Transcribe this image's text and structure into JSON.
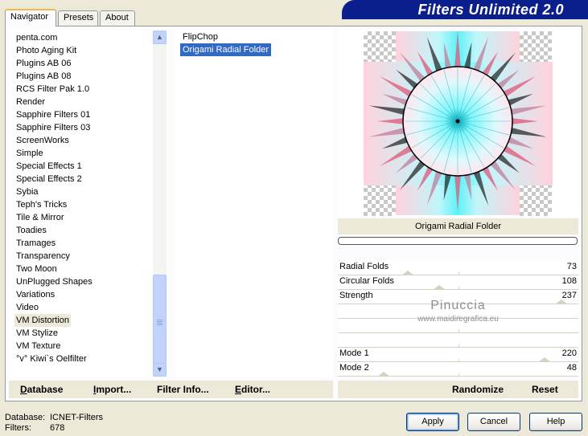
{
  "window": {
    "title": "Filters Unlimited 2.0"
  },
  "tabs": [
    {
      "label": "Navigator",
      "active": true
    },
    {
      "label": "Presets",
      "active": false
    },
    {
      "label": "About",
      "active": false
    }
  ],
  "categories": {
    "items": [
      "penta.com",
      "Photo Aging Kit",
      "Plugins AB 06",
      "Plugins AB 08",
      "RCS Filter Pak 1.0",
      "Render",
      "Sapphire Filters 01",
      "Sapphire Filters 03",
      "ScreenWorks",
      "Simple",
      "Special Effects 1",
      "Special Effects 2",
      "Sybia",
      "Teph's Tricks",
      "Tile & Mirror",
      "Toadies",
      "Tramages",
      "Transparency",
      "Two Moon",
      "UnPlugged Shapes",
      "Variations",
      "Video",
      "VM Distortion",
      "VM Stylize",
      "VM Texture",
      "°v° Kiwi`s Oelfilter"
    ],
    "selected_index": 22
  },
  "filters": {
    "items": [
      "FlipChop",
      "Origami Radial Folder"
    ],
    "selected_index": 1
  },
  "preview": {
    "filter_name": "Origami Radial Folder"
  },
  "sliders": [
    {
      "label": "Radial Folds",
      "value": "73",
      "fraction": 0.29
    },
    {
      "label": "Circular Folds",
      "value": "108",
      "fraction": 0.42
    },
    {
      "label": "Strength",
      "value": "237",
      "fraction": 0.93
    },
    {
      "label": "Mode 1",
      "value": "220",
      "fraction": 0.86
    },
    {
      "label": "Mode 2",
      "value": "48",
      "fraction": 0.19
    }
  ],
  "watermark": {
    "line1": "Pinuccia",
    "line2": "www.maidiregrafica.eu"
  },
  "left_buttons": [
    {
      "label": "Database",
      "underline": "D",
      "rest": "atabase"
    },
    {
      "label": "Import...",
      "underline": "I",
      "rest": "mport..."
    },
    {
      "label": "Filter Info...",
      "underline": "",
      "rest": "Filter Info..."
    },
    {
      "label": "Editor...",
      "underline": "E",
      "rest": "ditor..."
    }
  ],
  "right_buttons": {
    "randomize": "Randomize",
    "reset": "Reset"
  },
  "status": {
    "database_label": "Database:",
    "database_value": "ICNET-Filters",
    "filters_label": "Filters:",
    "filters_value": "678"
  },
  "dialog_buttons": {
    "apply": "Apply",
    "cancel": "Cancel",
    "help": "Help"
  }
}
